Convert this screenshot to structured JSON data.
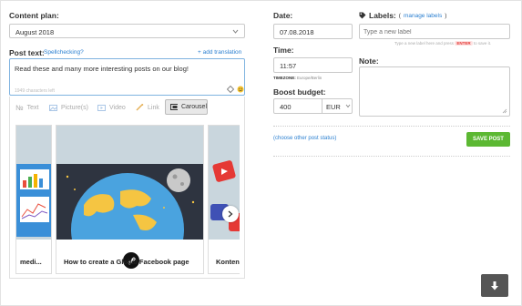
{
  "content_plan": {
    "label": "Content plan:",
    "selected": "August 2018"
  },
  "post_text": {
    "label": "Post text:",
    "spellcheck_link": "Spellchecking?",
    "add_translation": "+ add translation",
    "value": "Read these and many more interesting posts on our blog!",
    "chars_left": "1949 characters left"
  },
  "tabs": [
    {
      "label": "Text",
      "icon": "text-icon"
    },
    {
      "label": "Picture(s)",
      "icon": "picture-icon"
    },
    {
      "label": "Video",
      "icon": "video-icon"
    },
    {
      "label": "Link",
      "icon": "link-icon"
    },
    {
      "label": "Carousel",
      "icon": "carousel-icon",
      "active": true
    }
  ],
  "carousel": {
    "cards": [
      {
        "title": "medi..."
      },
      {
        "title": "How to create a Global Facebook page"
      },
      {
        "title": "Konten"
      }
    ]
  },
  "date": {
    "label": "Date:",
    "value": "07.08.2018"
  },
  "time": {
    "label": "Time:",
    "value": "11:57",
    "timezone_label": "TIMEZONE:",
    "timezone": "Europe/Berlin"
  },
  "boost": {
    "label": "Boost budget:",
    "value": "400",
    "currency": "EUR"
  },
  "labels": {
    "label": "Labels:",
    "manage_link": "manage labels",
    "placeholder": "Type a new label",
    "hint_pre": "Type a new label here and press",
    "hint_key": "ENTER",
    "hint_post": "to save it."
  },
  "note": {
    "label": "Note:"
  },
  "choose_status": "choose other post status",
  "save_post": "SAVE POST",
  "colors": {
    "green": "#5cb833",
    "link": "#2a7fd0",
    "dark_button": "#555555"
  }
}
